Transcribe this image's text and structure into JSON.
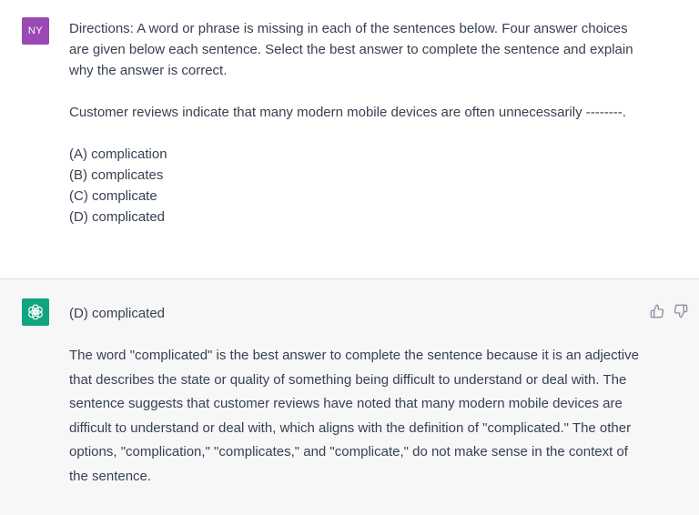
{
  "user": {
    "avatar_initials": "NY",
    "avatar_color": "#9b49b5",
    "directions": "Directions: A word or phrase is missing in each of the sentences below. Four answer choices are given below each sentence. Select the best answer to complete the sentence and explain why the answer is correct.",
    "question": "Customer reviews indicate that many modern mobile devices are often unnecessarily --------.",
    "options": [
      "(A) complication",
      "(B) complicates",
      "(C) complicate",
      "(D) complicated"
    ]
  },
  "assistant": {
    "avatar_icon": "openai-logo-icon",
    "avatar_color": "#10a37f",
    "answer": "(D) complicated",
    "explanation": "The word \"complicated\" is the best answer to complete the sentence because it is an adjective that describes the state or quality of something being difficult to understand or deal with. The sentence suggests that customer reviews have noted that many modern mobile devices are difficult to understand or deal with, which aligns with the definition of \"complicated.\" The other options, \"complication,\" \"complicates,\" and \"complicate,\" do not make sense in the context of the sentence.",
    "feedback_icons": [
      "thumbs-up-icon",
      "thumbs-down-icon"
    ]
  }
}
